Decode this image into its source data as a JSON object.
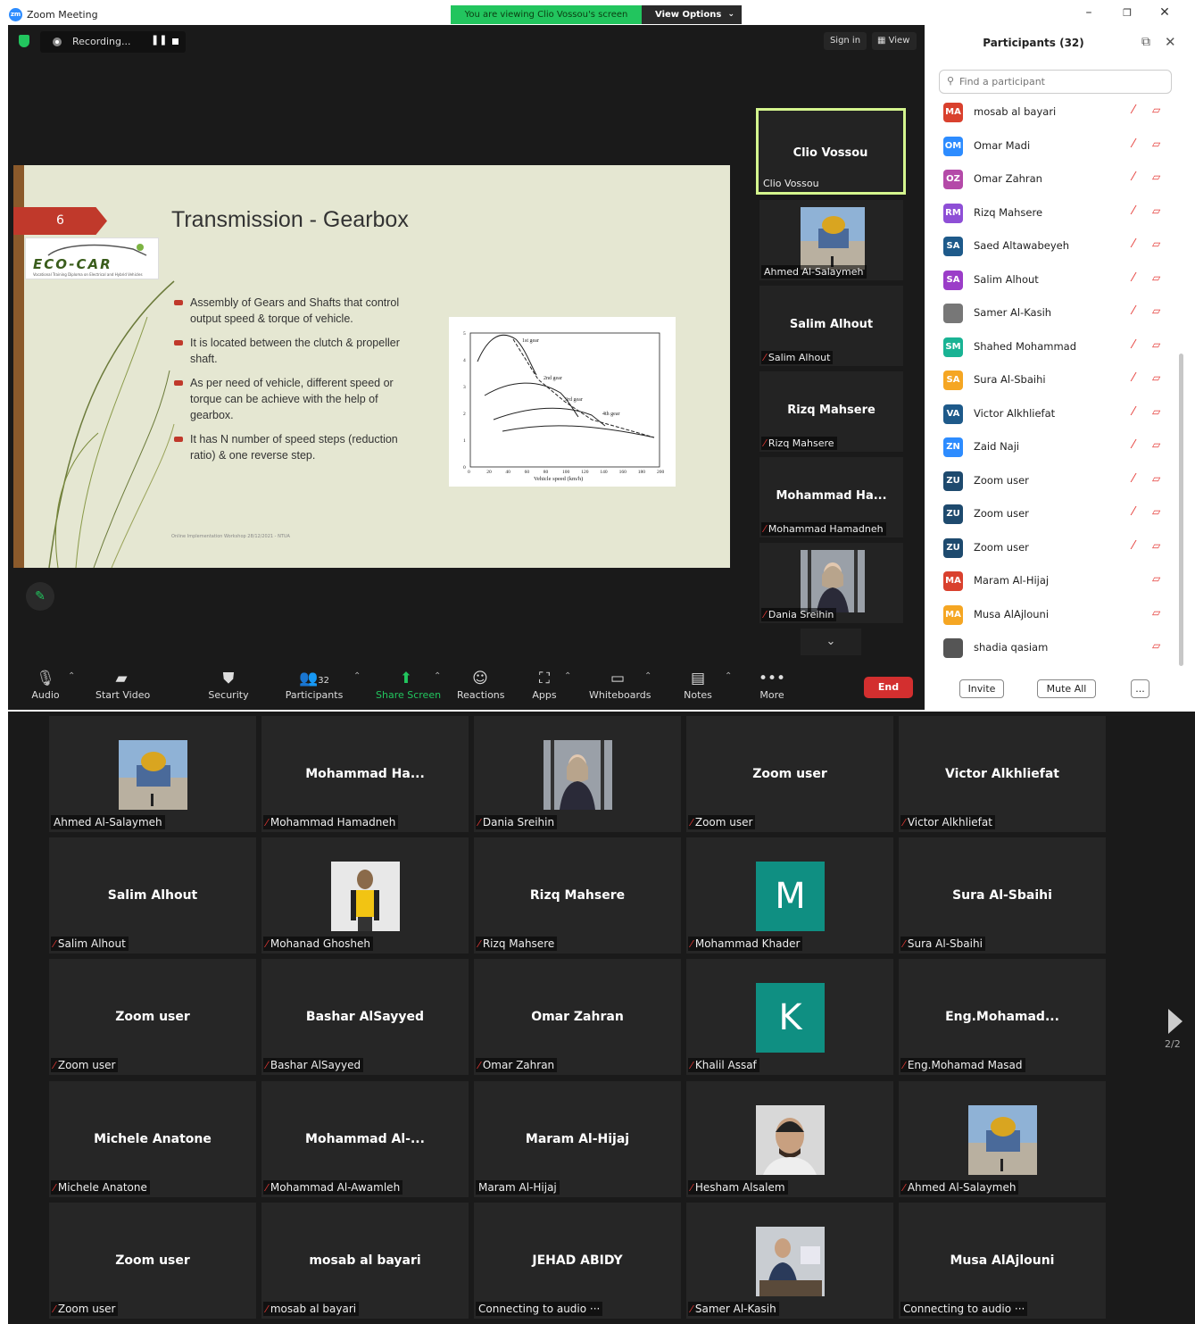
{
  "window": {
    "title": "Zoom Meeting",
    "logo": "zm"
  },
  "banner": {
    "viewing": "You are viewing Clio Vossou's screen",
    "view_options": "View Options"
  },
  "topbar": {
    "recording": "Recording...",
    "sign_in": "Sign in",
    "view": "View"
  },
  "slide": {
    "number": "6",
    "title": "Transmission - Gearbox",
    "logo_text": "ECO-CAR",
    "logo_sub": "Vocational Training Diploma on Electrical and Hybrid Vehicles",
    "bullets": [
      "Assembly of Gears and Shafts that control output speed & torque of vehicle.",
      "It is located between the clutch & propeller shaft.",
      "As per need of vehicle, different speed or torque can be achieve with the help of gearbox.",
      "It has N number of speed steps (reduction ratio) & one reverse step."
    ],
    "footer": "Online Implementation Workshop 28/12/2021 - NTUA",
    "graph": {
      "xlabel": "Vehicle speed (km/h)",
      "xticks": [
        "0",
        "20",
        "40",
        "60",
        "80",
        "100",
        "120",
        "140",
        "160",
        "180",
        "200"
      ],
      "yticks": [
        "0",
        "1",
        "2",
        "3",
        "4",
        "5"
      ],
      "gear_labels": [
        "1st gear",
        "2nd gear",
        "3rd gear",
        "4th gear"
      ]
    }
  },
  "side_videos": [
    {
      "name": "Clio Vossou",
      "label": "Clio Vossou",
      "muted": false
    },
    {
      "name": "",
      "label": "Ahmed Al-Salaymeh",
      "muted": false
    },
    {
      "name": "Salim Alhout",
      "label": "Salim Alhout",
      "muted": true
    },
    {
      "name": "Rizq Mahsere",
      "label": "Rizq Mahsere",
      "muted": true
    },
    {
      "name": "Mohammad  Ha...",
      "label": "Mohammad Hamadneh",
      "muted": true
    },
    {
      "name": "",
      "label": "Dania Sreihin",
      "muted": true
    }
  ],
  "toolbar": {
    "audio": "Audio",
    "start_video": "Start Video",
    "security": "Security",
    "participants": "Participants",
    "participants_count": "32",
    "share_screen": "Share Screen",
    "reactions": "Reactions",
    "apps": "Apps",
    "whiteboards": "Whiteboards",
    "notes": "Notes",
    "more": "More",
    "end": "End"
  },
  "panel": {
    "title": "Participants (32)",
    "search_placeholder": "Find a participant",
    "invite": "Invite",
    "mute_all": "Mute All",
    "more": "...",
    "participants": [
      {
        "initials": "MA",
        "name": "mosab al bayari",
        "color": "#d9412e",
        "mic_muted": true
      },
      {
        "initials": "OM",
        "name": "Omar Madi",
        "color": "#2d8cff",
        "mic_muted": true
      },
      {
        "initials": "OZ",
        "name": "Omar Zahran",
        "color": "#b44aa8",
        "mic_muted": true
      },
      {
        "initials": "RM",
        "name": "Rizq Mahsere",
        "color": "#8e4fd6",
        "mic_muted": true
      },
      {
        "initials": "SA",
        "name": "Saed Altawabeyeh",
        "color": "#1e5a8a",
        "mic_muted": true
      },
      {
        "initials": "SA",
        "name": "Salim Alhout",
        "color": "#9b3dc8",
        "mic_muted": true
      },
      {
        "initials": "",
        "name": "Samer Al-Kasih",
        "color": "#777777",
        "mic_muted": true
      },
      {
        "initials": "SM",
        "name": "Shahed Mohammad",
        "color": "#19b394",
        "mic_muted": true
      },
      {
        "initials": "SA",
        "name": "Sura Al-Sbaihi",
        "color": "#f5a623",
        "mic_muted": true
      },
      {
        "initials": "VA",
        "name": "Victor Alkhliefat",
        "color": "#1e5a8a",
        "mic_muted": true
      },
      {
        "initials": "ZN",
        "name": "Zaid Naji",
        "color": "#2d8cff",
        "mic_muted": true
      },
      {
        "initials": "ZU",
        "name": "Zoom user",
        "color": "#1e4a6e",
        "mic_muted": true
      },
      {
        "initials": "ZU",
        "name": "Zoom user",
        "color": "#1e4a6e",
        "mic_muted": true
      },
      {
        "initials": "ZU",
        "name": "Zoom user",
        "color": "#1e4a6e",
        "mic_muted": true
      },
      {
        "initials": "MA",
        "name": "Maram Al-Hijaj",
        "color": "#d9412e",
        "mic_muted": false
      },
      {
        "initials": "MA",
        "name": "Musa AlAjlouni",
        "color": "#f5a623",
        "mic_muted": false
      },
      {
        "initials": "",
        "name": "shadia qasiam",
        "color": "#555555",
        "mic_muted": false
      }
    ]
  },
  "gallery": {
    "page": "2/2",
    "tiles": [
      {
        "name": "",
        "label": "Ahmed Al-Salaymeh",
        "muted": false,
        "kind": "dome"
      },
      {
        "name": "Mohammad  Ha...",
        "label": "Mohammad Hamadneh",
        "muted": true,
        "kind": "text"
      },
      {
        "name": "",
        "label": "Dania Sreihin",
        "muted": true,
        "kind": "person"
      },
      {
        "name": "Zoom user",
        "label": "Zoom user",
        "muted": true,
        "kind": "text"
      },
      {
        "name": "Victor Alkhliefat",
        "label": "Victor Alkhliefat",
        "muted": true,
        "kind": "text"
      },
      {
        "name": "Salim Alhout",
        "label": "Salim Alhout",
        "muted": true,
        "kind": "text"
      },
      {
        "name": "",
        "label": "Mohanad Ghosheh",
        "muted": true,
        "kind": "person2"
      },
      {
        "name": "Rizq Mahsere",
        "label": "Rizq Mahsere",
        "muted": true,
        "kind": "text"
      },
      {
        "name": "M",
        "label": "Mohammad Khader",
        "muted": true,
        "kind": "letter"
      },
      {
        "name": "Sura Al-Sbaihi",
        "label": "Sura Al-Sbaihi",
        "muted": true,
        "kind": "text"
      },
      {
        "name": "Zoom user",
        "label": "Zoom user",
        "muted": true,
        "kind": "text"
      },
      {
        "name": "Bashar AlSayyed",
        "label": "Bashar AlSayyed",
        "muted": true,
        "kind": "text"
      },
      {
        "name": "Omar Zahran",
        "label": "Omar Zahran",
        "muted": true,
        "kind": "text"
      },
      {
        "name": "K",
        "label": "Khalil Assaf",
        "muted": true,
        "kind": "letter"
      },
      {
        "name": "Eng.Mohamad...",
        "label": "Eng.Mohamad Masad",
        "muted": true,
        "kind": "text"
      },
      {
        "name": "Michele Anatone",
        "label": "Michele Anatone",
        "muted": true,
        "kind": "text"
      },
      {
        "name": "Mohammad  Al-...",
        "label": "Mohammad Al-Awamleh",
        "muted": true,
        "kind": "text"
      },
      {
        "name": "Maram Al-Hijaj",
        "label": "Maram Al-Hijaj",
        "muted": false,
        "kind": "text"
      },
      {
        "name": "",
        "label": "Hesham Alsalem",
        "muted": true,
        "kind": "face"
      },
      {
        "name": "",
        "label": "Ahmed Al-Salaymeh",
        "muted": true,
        "kind": "dome"
      },
      {
        "name": "Zoom user",
        "label": "Zoom user",
        "muted": true,
        "kind": "text"
      },
      {
        "name": "mosab al bayari",
        "label": "mosab al bayari",
        "muted": true,
        "kind": "text"
      },
      {
        "name": "JEHAD ABIDY",
        "label": "Connecting to audio ···",
        "muted": false,
        "kind": "text"
      },
      {
        "name": "",
        "label": "Samer Al-Kasih",
        "muted": true,
        "kind": "office"
      },
      {
        "name": "Musa AlAjlouni",
        "label": "Connecting to audio ···",
        "muted": false,
        "kind": "text"
      }
    ]
  }
}
